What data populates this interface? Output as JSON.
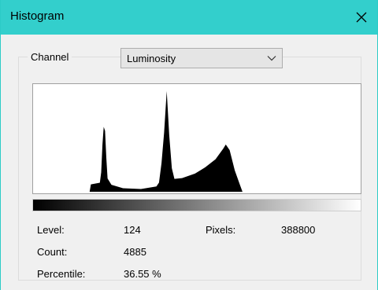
{
  "window": {
    "title": "Histogram",
    "titlebar_color": "#33cfcc",
    "close_icon": "close-icon"
  },
  "channel": {
    "label": "Channel",
    "selected": "Luminosity"
  },
  "histogram": {
    "axis_min": 0,
    "axis_max": 255,
    "fill_color": "#000000",
    "peaks": [
      {
        "level": 55,
        "relative_height": 0.66
      },
      {
        "level": 104,
        "relative_height": 1.0
      },
      {
        "level": 150,
        "relative_height": 0.46
      }
    ]
  },
  "stats": {
    "level_label": "Level:",
    "level_value": "124",
    "pixels_label": "Pixels:",
    "pixels_value": "388800",
    "count_label": "Count:",
    "count_value": "4885",
    "percentile_label": "Percentile:",
    "percentile_value": "36.55 %"
  }
}
